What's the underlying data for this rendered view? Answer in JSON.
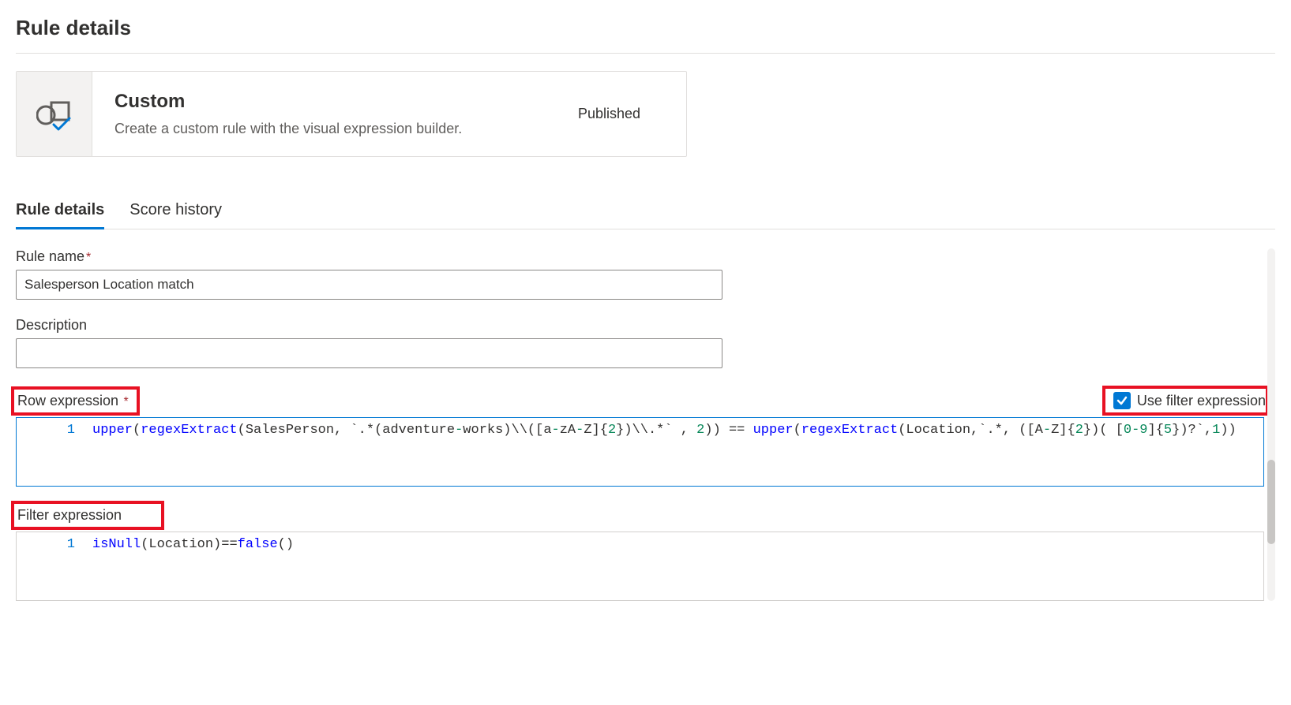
{
  "page": {
    "title": "Rule details"
  },
  "card": {
    "title": "Custom",
    "description": "Create a custom rule with the visual expression builder.",
    "status": "Published"
  },
  "tabs": [
    {
      "label": "Rule details",
      "active": true
    },
    {
      "label": "Score history",
      "active": false
    }
  ],
  "form": {
    "rule_name": {
      "label": "Rule name",
      "required": true,
      "value": "Salesperson Location match"
    },
    "description": {
      "label": "Description",
      "value": ""
    },
    "row_expression": {
      "label": "Row expression",
      "required": true,
      "checkbox_label": "Use filter expression",
      "checkbox_checked": true,
      "lines": [
        {
          "num": "1",
          "tokens": [
            {
              "t": "upper",
              "c": "fn"
            },
            {
              "t": "(",
              "c": "op"
            },
            {
              "t": "regexExtract",
              "c": "fn"
            },
            {
              "t": "(SalesPerson, `.*(adventure",
              "c": "op"
            },
            {
              "t": "-",
              "c": "num"
            },
            {
              "t": "works)\\\\([a",
              "c": "op"
            },
            {
              "t": "-",
              "c": "num"
            },
            {
              "t": "zA",
              "c": "op"
            },
            {
              "t": "-",
              "c": "num"
            },
            {
              "t": "Z]{",
              "c": "op"
            },
            {
              "t": "2",
              "c": "num"
            },
            {
              "t": "})\\\\.*` , ",
              "c": "op"
            },
            {
              "t": "2",
              "c": "num"
            },
            {
              "t": ")) ",
              "c": "op"
            },
            {
              "t": "==",
              "c": "op"
            },
            {
              "t": " ",
              "c": "op"
            },
            {
              "t": "upper",
              "c": "fn"
            },
            {
              "t": "(",
              "c": "op"
            },
            {
              "t": "regexExtract",
              "c": "fn"
            },
            {
              "t": "(Location,`.*, ([A",
              "c": "op"
            },
            {
              "t": "-",
              "c": "num"
            },
            {
              "t": "Z]{",
              "c": "op"
            },
            {
              "t": "2",
              "c": "num"
            },
            {
              "t": "})( [",
              "c": "op"
            },
            {
              "t": "0-9",
              "c": "num"
            },
            {
              "t": "]{",
              "c": "op"
            },
            {
              "t": "5",
              "c": "num"
            },
            {
              "t": "})?`,",
              "c": "op"
            },
            {
              "t": "1",
              "c": "num"
            },
            {
              "t": "))",
              "c": "op"
            }
          ]
        }
      ]
    },
    "filter_expression": {
      "label": "Filter expression",
      "lines": [
        {
          "num": "1",
          "tokens": [
            {
              "t": "isNull",
              "c": "fn"
            },
            {
              "t": "(Location)",
              "c": "op"
            },
            {
              "t": "==",
              "c": "op"
            },
            {
              "t": "false",
              "c": "fn"
            },
            {
              "t": "()",
              "c": "op"
            }
          ]
        }
      ]
    }
  }
}
